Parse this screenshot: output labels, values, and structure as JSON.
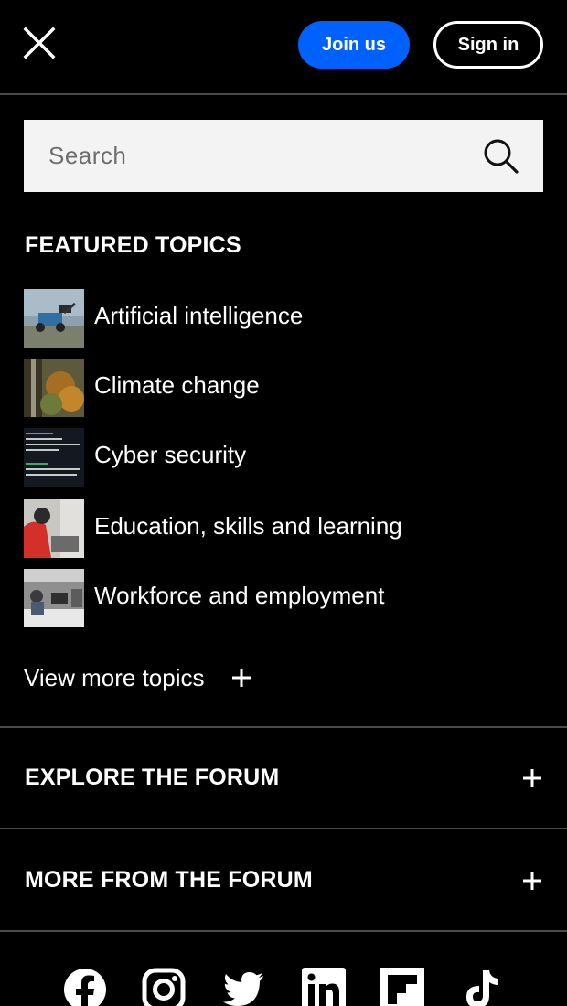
{
  "header": {
    "join_label": "Join us",
    "signin_label": "Sign in",
    "join_color": "#0061ff"
  },
  "search": {
    "placeholder": "Search"
  },
  "featured": {
    "title": "FEATURED TOPICS",
    "topics": [
      {
        "label": "Artificial intelligence"
      },
      {
        "label": "Climate change"
      },
      {
        "label": "Cyber security"
      },
      {
        "label": "Education, skills and learning"
      },
      {
        "label": "Workforce and employment"
      }
    ],
    "view_more_label": "View more topics"
  },
  "sections": {
    "explore_label": "EXPLORE THE FORUM",
    "more_label": "MORE FROM THE FORUM"
  },
  "social": [
    "facebook-icon",
    "instagram-icon",
    "twitter-icon",
    "linkedin-icon",
    "flipboard-icon",
    "tiktok-icon"
  ]
}
